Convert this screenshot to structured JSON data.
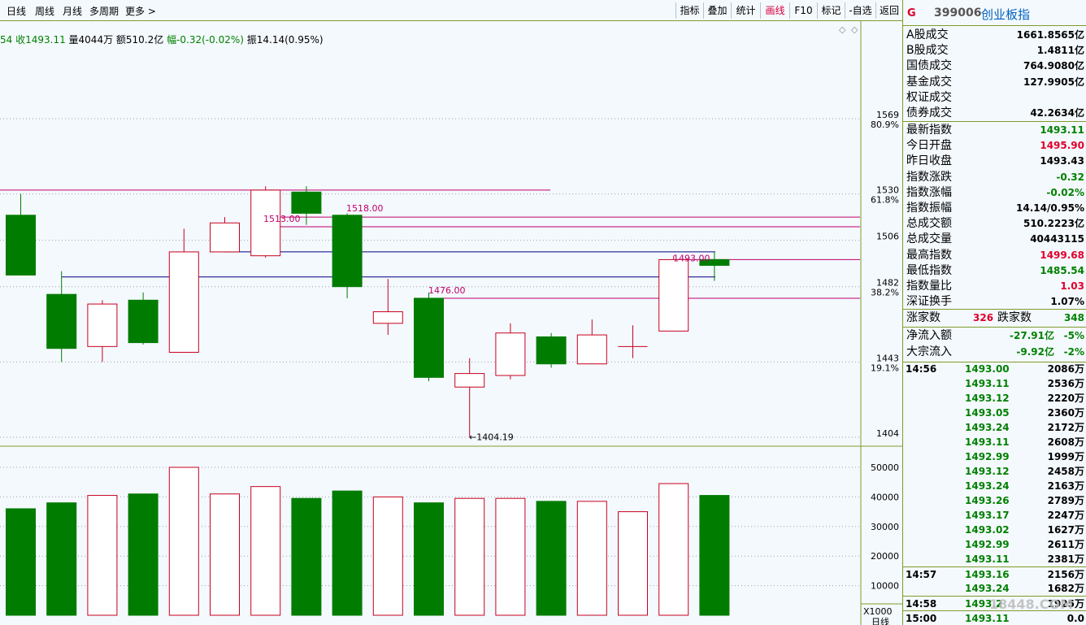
{
  "toolbar": {
    "left_tabs": [
      "日线",
      "周线",
      "月线",
      "多周期",
      "更多 >"
    ],
    "right_tabs": [
      "指标",
      "叠加",
      "统计",
      "画线",
      "F10",
      "标记",
      "-自选",
      "返回"
    ],
    "active_right_tab": "画线"
  },
  "info_line": {
    "part1": "54 收1493.11",
    "part2": " 量4044万 额510.2亿 ",
    "part3": "幅-0.32(-0.02%)",
    "part4": " 振14.14(0.95%)"
  },
  "colors": {
    "up": "#c8001e",
    "down": "#007c00",
    "pink": "#c0006a",
    "navy": "#000080",
    "grid": "#a0a0a0",
    "axis": "#7e9b2b"
  },
  "chart_data": {
    "type": "candlestick",
    "price_axis": {
      "ticks": [
        {
          "price": 1569,
          "label": "1569",
          "pct": "80.9%"
        },
        {
          "price": 1530,
          "label": "1530",
          "pct": "61.8%"
        },
        {
          "price": 1506,
          "label": "1506",
          "pct": ""
        },
        {
          "price": 1482,
          "label": "1482",
          "pct": "38.2%"
        },
        {
          "price": 1443,
          "label": "1443",
          "pct": "19.1%"
        },
        {
          "price": 1404,
          "label": "1404",
          "pct": ""
        }
      ]
    },
    "volume_axis": {
      "ticks": [
        "50000",
        "40000",
        "30000",
        "20000",
        "10000"
      ],
      "unit": "X1000"
    },
    "candles": [
      {
        "open": 1519,
        "close": 1488,
        "high": 1530,
        "low": 1488,
        "volume": 36000
      },
      {
        "open": 1478,
        "close": 1450,
        "high": 1490,
        "low": 1443,
        "volume": 38000
      },
      {
        "open": 1451,
        "close": 1473,
        "high": 1475,
        "low": 1443,
        "volume": 40500
      },
      {
        "open": 1475,
        "close": 1453,
        "high": 1479,
        "low": 1452,
        "volume": 41000
      },
      {
        "open": 1448,
        "close": 1500,
        "high": 1512,
        "low": 1448,
        "volume": 50000
      },
      {
        "open": 1500,
        "close": 1515,
        "high": 1518,
        "low": 1500,
        "volume": 41000
      },
      {
        "open": 1498,
        "close": 1532,
        "high": 1534,
        "low": 1497,
        "volume": 43500
      },
      {
        "open": 1531,
        "close": 1520,
        "high": 1534,
        "low": 1514,
        "volume": 39500
      },
      {
        "open": 1519,
        "close": 1482,
        "high": 1520,
        "low": 1476,
        "volume": 42000
      },
      {
        "open": 1463,
        "close": 1469,
        "high": 1486,
        "low": 1457,
        "volume": 40000
      },
      {
        "open": 1476,
        "close": 1435,
        "high": 1479,
        "low": 1433,
        "volume": 38000
      },
      {
        "open": 1430,
        "close": 1437,
        "high": 1445,
        "low": 1404.19,
        "volume": 39500
      },
      {
        "open": 1436,
        "close": 1458,
        "high": 1463,
        "low": 1434,
        "volume": 39500
      },
      {
        "open": 1456,
        "close": 1442,
        "high": 1458,
        "low": 1440,
        "volume": 38500
      },
      {
        "open": 1442,
        "close": 1457,
        "high": 1465,
        "low": 1442,
        "volume": 38500
      },
      {
        "open": 1450,
        "close": 1451,
        "high": 1462,
        "low": 1445,
        "volume": 35000
      },
      {
        "open": 1459,
        "close": 1496,
        "high": 1498,
        "low": 1459,
        "volume": 44500
      },
      {
        "open": 1496,
        "close": 1493,
        "high": 1500,
        "low": 1485,
        "volume": 40500
      }
    ],
    "annotations": [
      {
        "text": "1518.00",
        "price": 1518
      },
      {
        "text": "1513.00",
        "price": 1513
      },
      {
        "text": "1493.00",
        "price": 1493
      },
      {
        "text": "1476.00",
        "price": 1476
      },
      {
        "text": "←1404.19",
        "price": 1404.19
      }
    ]
  },
  "right_panel": {
    "title_icon": "G",
    "code": "399006",
    "name": "创业板指",
    "rows1": [
      {
        "k": "A股成交",
        "v": "1661.8565亿",
        "c": "#000"
      },
      {
        "k": "B股成交",
        "v": "1.4811亿",
        "c": "#000"
      },
      {
        "k": "国债成交",
        "v": "764.9080亿",
        "c": "#000"
      },
      {
        "k": "基金成交",
        "v": "127.9905亿",
        "c": "#000"
      },
      {
        "k": "权证成交",
        "v": "",
        "c": "#000"
      },
      {
        "k": "债券成交",
        "v": "42.2634亿",
        "c": "#000"
      }
    ],
    "rows2": [
      {
        "k": "最新指数",
        "v": "1493.11",
        "c": "#008000"
      },
      {
        "k": "今日开盘",
        "v": "1495.90",
        "c": "#e0002a"
      },
      {
        "k": "昨日收盘",
        "v": "1493.43",
        "c": "#000"
      },
      {
        "k": "指数涨跌",
        "v": "-0.32",
        "c": "#008000"
      },
      {
        "k": "指数涨幅",
        "v": "-0.02%",
        "c": "#008000"
      },
      {
        "k": "指数振幅",
        "v": "14.14/0.95%",
        "c": "#000"
      },
      {
        "k": "总成交额",
        "v": "510.2223亿",
        "c": "#000"
      },
      {
        "k": "总成交量",
        "v": "40443115",
        "c": "#000"
      },
      {
        "k": "最高指数",
        "v": "1499.68",
        "c": "#e0002a"
      },
      {
        "k": "最低指数",
        "v": "1485.54",
        "c": "#008000"
      },
      {
        "k": "指数量比",
        "v": "1.03",
        "c": "#e0002a"
      },
      {
        "k": "深证换手",
        "v": "1.07%",
        "c": "#000"
      }
    ],
    "up_label": "涨家数",
    "up_value": "326",
    "down_label": "跌家数",
    "down_value": "348",
    "flows": [
      {
        "k": "净流入额",
        "v1": "-27.91亿",
        "v2": "-5%"
      },
      {
        "k": "大宗流入",
        "v1": "-9.92亿",
        "v2": "-2%"
      }
    ],
    "ticks": [
      {
        "time": "14:56",
        "price": "1493.00",
        "vol": "2086万"
      },
      {
        "time": "",
        "price": "1493.11",
        "vol": "2536万"
      },
      {
        "time": "",
        "price": "1493.12",
        "vol": "2220万"
      },
      {
        "time": "",
        "price": "1493.05",
        "vol": "2360万"
      },
      {
        "time": "",
        "price": "1493.24",
        "vol": "2172万"
      },
      {
        "time": "",
        "price": "1493.11",
        "vol": "2608万"
      },
      {
        "time": "",
        "price": "1492.99",
        "vol": "1999万"
      },
      {
        "time": "",
        "price": "1493.12",
        "vol": "2458万"
      },
      {
        "time": "",
        "price": "1493.24",
        "vol": "2163万"
      },
      {
        "time": "",
        "price": "1493.26",
        "vol": "2789万"
      },
      {
        "time": "",
        "price": "1493.17",
        "vol": "2247万"
      },
      {
        "time": "",
        "price": "1493.02",
        "vol": "1627万"
      },
      {
        "time": "",
        "price": "1492.99",
        "vol": "2611万"
      },
      {
        "time": "",
        "price": "1493.11",
        "vol": "2381万"
      },
      {
        "time": "14:57",
        "price": "1493.16",
        "vol": "2156万"
      },
      {
        "time": "",
        "price": "1493.24",
        "vol": "1682万"
      },
      {
        "time": "14:58",
        "price": "1493.2",
        "vol": "1925万"
      },
      {
        "time": "15:00",
        "price": "1493.11",
        "vol": "0.0"
      }
    ],
    "watermark": "18448.COM"
  },
  "bottom_label": "日线"
}
